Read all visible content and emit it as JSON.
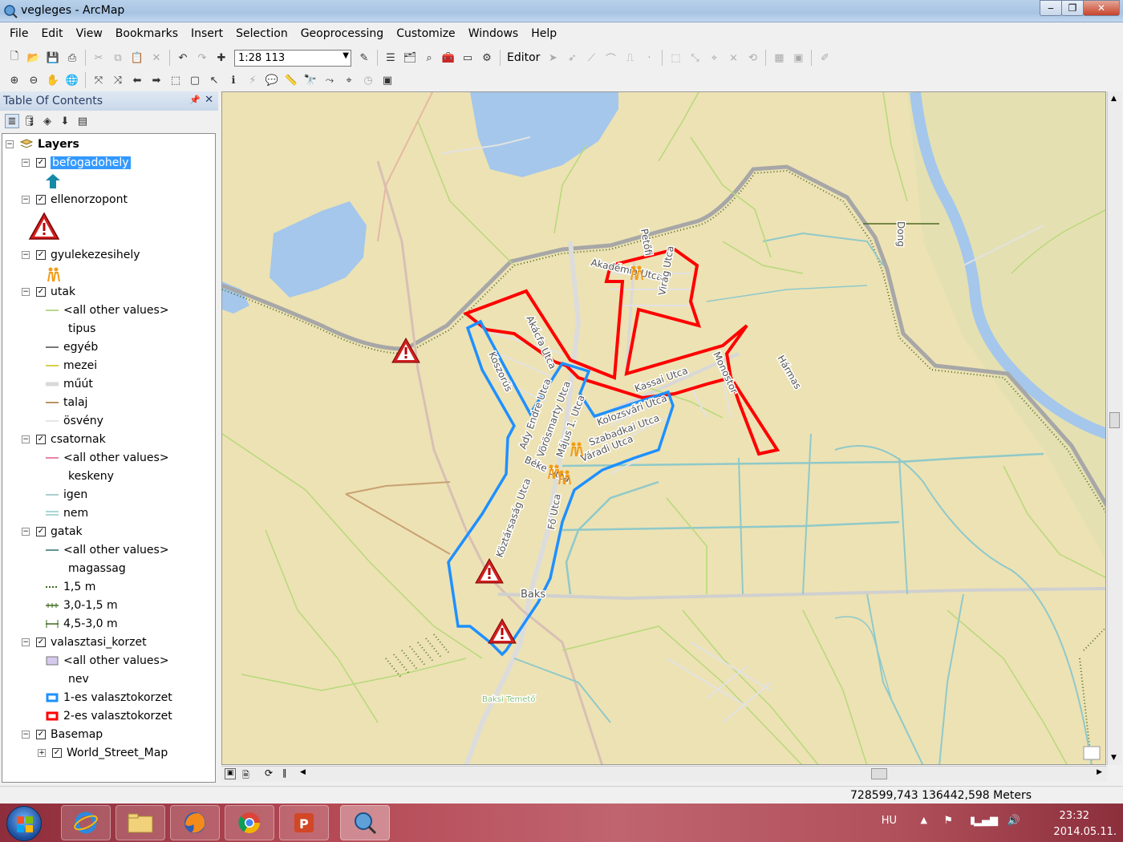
{
  "window": {
    "title": "vegleges - ArcMap"
  },
  "menu": [
    "File",
    "Edit",
    "View",
    "Bookmarks",
    "Insert",
    "Selection",
    "Geoprocessing",
    "Customize",
    "Windows",
    "Help"
  ],
  "toolbar": {
    "scale": "1:28 113",
    "editor_label": "Editor"
  },
  "toc": {
    "title": "Table Of Contents",
    "root": "Layers",
    "layers": {
      "befogadohely": "befogadohely",
      "ellenorzopont": "ellenorzopont",
      "gyulekezesihely": "gyulekezesihely",
      "utak": "utak",
      "utak_all": "<all other values>",
      "utak_field": "tipus",
      "utak_v1": "egyéb",
      "utak_v2": "mezei",
      "utak_v3": "műút",
      "utak_v4": "talaj",
      "utak_v5": "ösvény",
      "csatornak": "csatornak",
      "csat_all": "<all other values>",
      "csat_field": "keskeny",
      "csat_v1": "igen",
      "csat_v2": "nem",
      "gatak": "gatak",
      "gatak_all": "<all other values>",
      "gatak_field": "magassag",
      "gatak_v1": "1,5 m",
      "gatak_v2": "3,0-1,5 m",
      "gatak_v3": "4,5-3,0 m",
      "valasztasi": "valasztasi_korzet",
      "val_all": "<all other values>",
      "val_field": "nev",
      "val_v1": "1-es valasztokorzet",
      "val_v2": "2-es valasztokorzet",
      "basemap": "Basemap",
      "world": "World_Street_Map"
    }
  },
  "map": {
    "labels": {
      "akacfa": "Akácfa Utca",
      "koszorus": "Koszorús",
      "akademia": "Akadémia Utca",
      "virag": "Virág Utca",
      "petofi": "Petőfi",
      "kassai": "Kassai Utca",
      "monostor": "Monostor",
      "harmas": "Hármas",
      "dong": "Dong",
      "ady": "Ady Endre Utca",
      "vorosmarty": "Vörösmarty Utca",
      "majus": "Május 1. Utca",
      "kolozsvari": "Kolozsvári Utca",
      "szabadkai": "Szabadkai Utca",
      "varadi": "Váradi Utca",
      "beke": "Béke Utca",
      "fout": "Fő Utca",
      "koztarsasag": "Köztársaság Utca",
      "baks": "Baks",
      "temeto": "Baksi Temető"
    },
    "colors": {
      "korzet1": "#1e90ff",
      "korzet2": "#ff0000"
    }
  },
  "status": {
    "coords": "728599,743  136442,598 Meters"
  },
  "taskbar": {
    "lang": "HU",
    "time": "23:32",
    "date": "2014.05.11."
  }
}
